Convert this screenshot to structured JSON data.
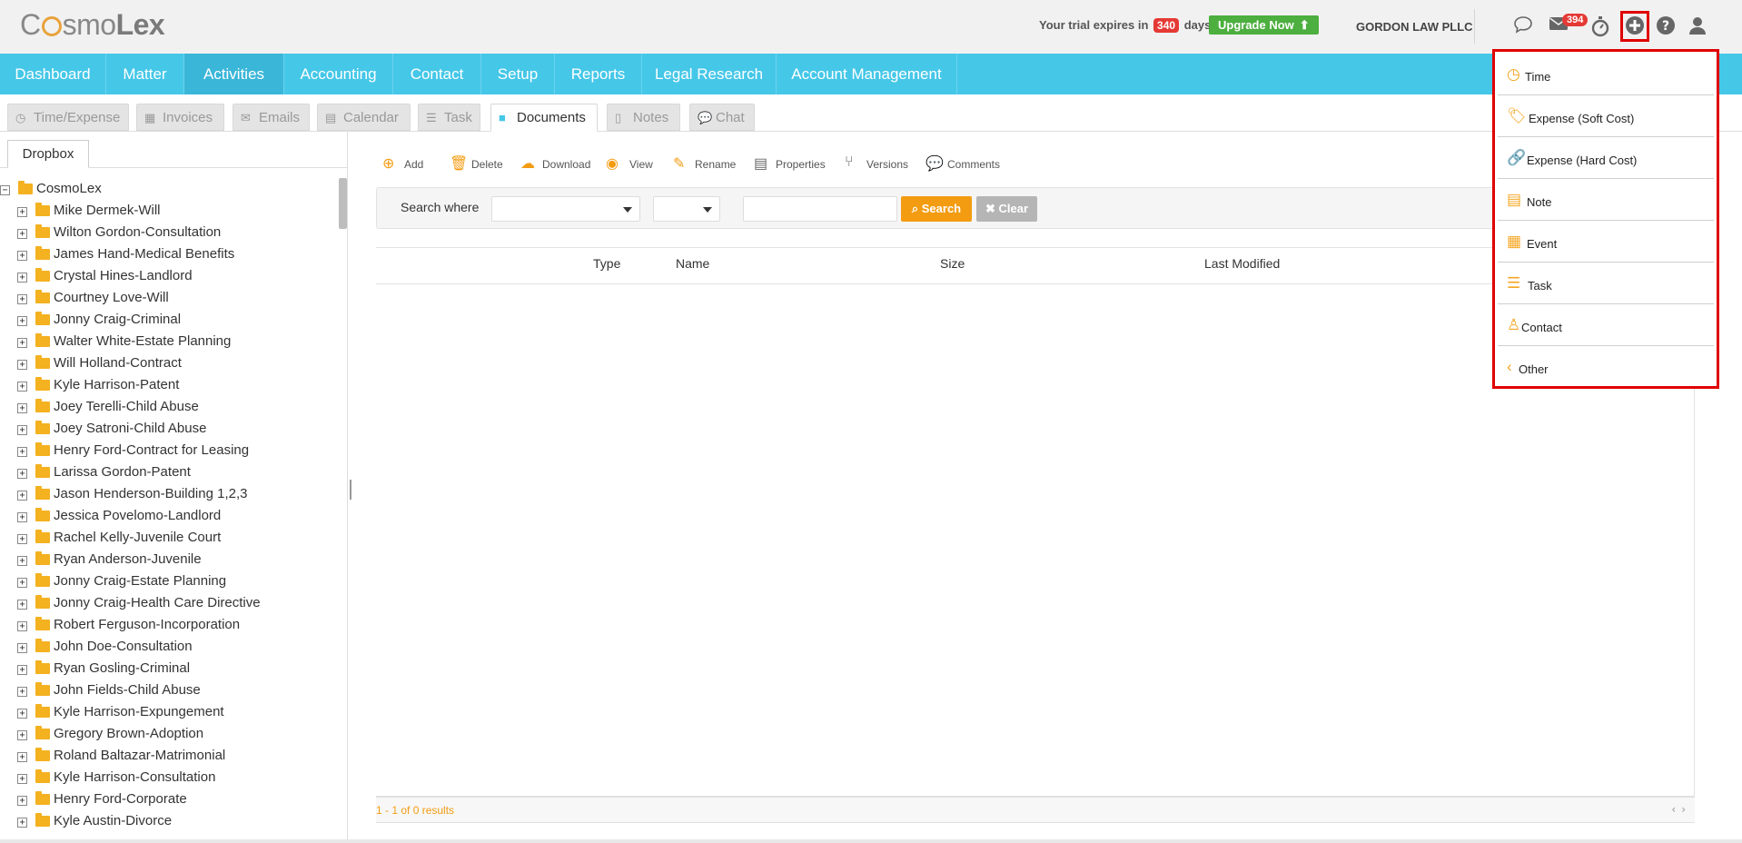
{
  "header": {
    "logo": {
      "cosmo_prefix": "C",
      "cosmo_suffix": "smo",
      "lex": "Lex"
    },
    "trial_prefix": "Your trial expires in",
    "trial_days": "340",
    "trial_suffix": "days.",
    "upgrade_label": "Upgrade Now",
    "firm_name": "GORDON LAW PLLC",
    "mail_count": "394",
    "icons": [
      "chat-icon",
      "mail-icon",
      "stopwatch-icon",
      "plus-circle-icon",
      "help-icon",
      "user-icon"
    ]
  },
  "nav": {
    "items": [
      "Dashboard",
      "Matter",
      "Activities",
      "Accounting",
      "Contact",
      "Setup",
      "Reports",
      "Legal Research",
      "Account Management"
    ],
    "active": "Activities"
  },
  "subtabs": {
    "items": [
      "Time/Expense",
      "Invoices",
      "Emails",
      "Calendar",
      "Task",
      "Documents",
      "Notes",
      "Chat"
    ],
    "active": "Documents"
  },
  "tree": {
    "tab_label": "Dropbox",
    "root": "CosmoLex",
    "folders": [
      "Mike Dermek-Will",
      "Wilton Gordon-Consultation",
      "James Hand-Medical Benefits",
      "Crystal Hines-Landlord",
      "Courtney Love-Will",
      "Jonny Craig-Criminal",
      "Walter White-Estate Planning",
      "Will Holland-Contract",
      "Kyle Harrison-Patent",
      "Joey Terelli-Child Abuse",
      "Joey Satroni-Child Abuse",
      "Henry Ford-Contract for Leasing",
      "Larissa Gordon-Patent",
      "Jason Henderson-Building 1,2,3",
      "Jessica Povelomo-Landlord",
      "Rachel Kelly-Juvenile Court",
      "Ryan Anderson-Juvenile",
      "Jonny Craig-Estate Planning",
      "Jonny Craig-Health Care Directive",
      "Robert Ferguson-Incorporation",
      "John Doe-Consultation",
      "Ryan Gosling-Criminal",
      "John Fields-Child Abuse",
      "Kyle Harrison-Expungement",
      "Gregory Brown-Adoption",
      "Roland Baltazar-Matrimonial",
      "Kyle Harrison-Consultation",
      "Henry Ford-Corporate",
      "Kyle Austin-Divorce"
    ]
  },
  "toolbar": {
    "add": "Add",
    "delete": "Delete",
    "download": "Download",
    "view": "View",
    "rename": "Rename",
    "properties": "Properties",
    "versions": "Versions",
    "comments": "Comments"
  },
  "search": {
    "label": "Search where",
    "field_value": "",
    "operator_value": "",
    "input_value": "",
    "search_button": "Search",
    "clear_button": "Clear"
  },
  "grid": {
    "columns": [
      "Type",
      "Name",
      "Size",
      "Last Modified"
    ],
    "rows": [],
    "pager": "1 - 1 of 0 results"
  },
  "quick_add": {
    "items": [
      {
        "label": "Time",
        "icon": "clock-icon"
      },
      {
        "label": "Expense (Soft Cost)",
        "icon": "tags-icon"
      },
      {
        "label": "Expense (Hard Cost)",
        "icon": "link-icon"
      },
      {
        "label": "Note",
        "icon": "note-icon"
      },
      {
        "label": "Event",
        "icon": "calendar-icon"
      },
      {
        "label": "Task",
        "icon": "tasks-icon"
      },
      {
        "label": "Contact",
        "icon": "person-icon"
      },
      {
        "label": "Other",
        "icon": "chevron-left-icon"
      }
    ]
  },
  "colors": {
    "nav_bg": "#45c7e8",
    "accent_orange": "#f39c12",
    "upgrade_green": "#4caf3f",
    "badge_red": "#e53935",
    "highlight_red": "#e00000"
  }
}
